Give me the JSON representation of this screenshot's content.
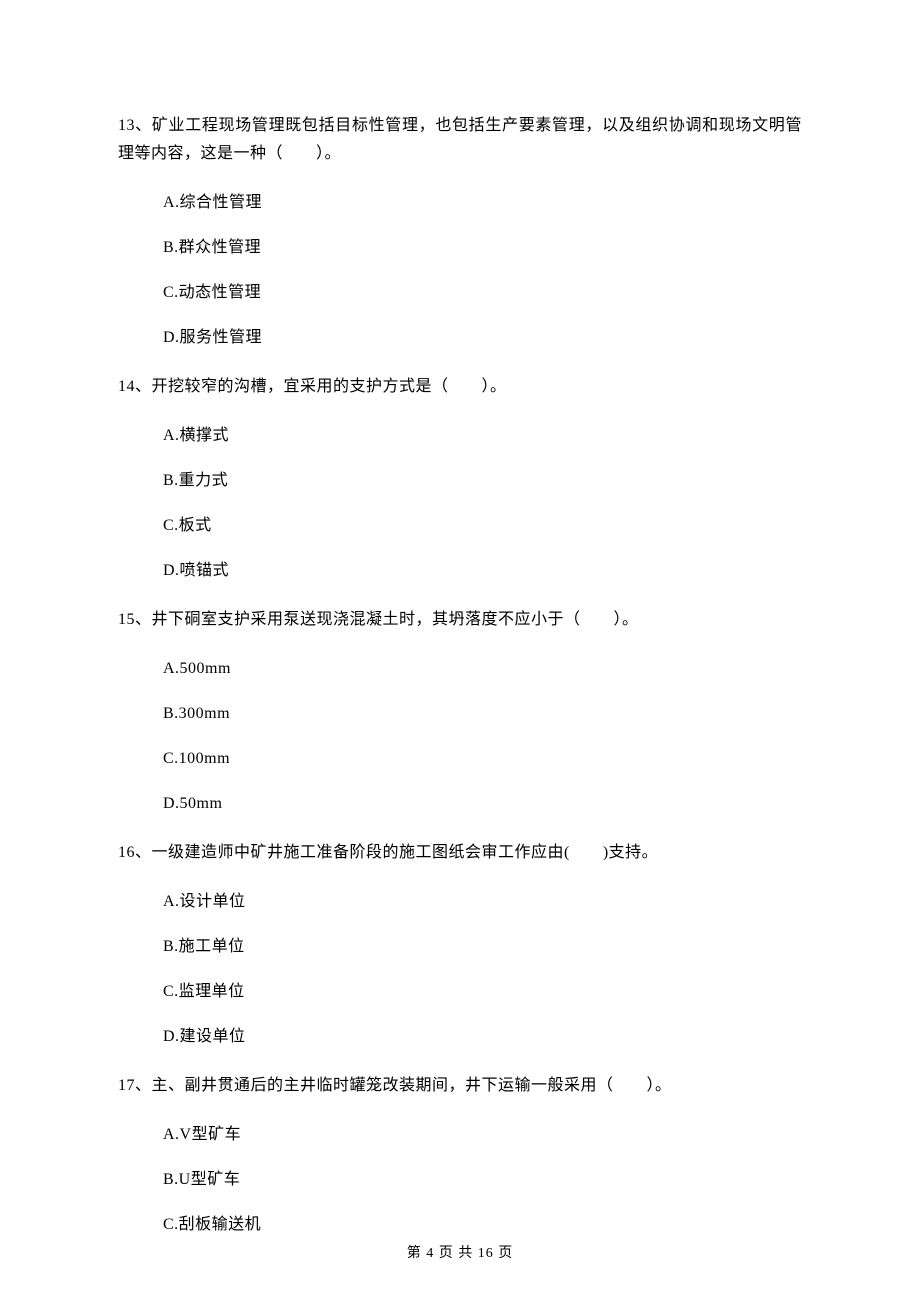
{
  "q13": {
    "text": "13、矿业工程现场管理既包括目标性管理，也包括生产要素管理，以及组织协调和现场文明管理等内容，这是一种（　　）。",
    "optA": "A.综合性管理",
    "optB": "B.群众性管理",
    "optC": "C.动态性管理",
    "optD": "D.服务性管理"
  },
  "q14": {
    "text": "14、开挖较窄的沟槽，宜采用的支护方式是（　　）。",
    "optA": "A.横撑式",
    "optB": "B.重力式",
    "optC": "C.板式",
    "optD": "D.喷锚式"
  },
  "q15": {
    "text": "15、井下硐室支护采用泵送现浇混凝土时，其坍落度不应小于（　　）。",
    "optA": "A.500mm",
    "optB": "B.300mm",
    "optC": "C.100mm",
    "optD": "D.50mm"
  },
  "q16": {
    "text": "16、一级建造师中矿井施工准备阶段的施工图纸会审工作应由(　　)支持。",
    "optA": "A.设计单位",
    "optB": "B.施工单位",
    "optC": "C.监理单位",
    "optD": "D.建设单位"
  },
  "q17": {
    "text": "17、主、副井贯通后的主井临时罐笼改装期间，井下运输一般采用（　　）。",
    "optA": "A.V型矿车",
    "optB": "B.U型矿车",
    "optC": "C.刮板输送机"
  },
  "footer": "第 4 页 共 16 页"
}
